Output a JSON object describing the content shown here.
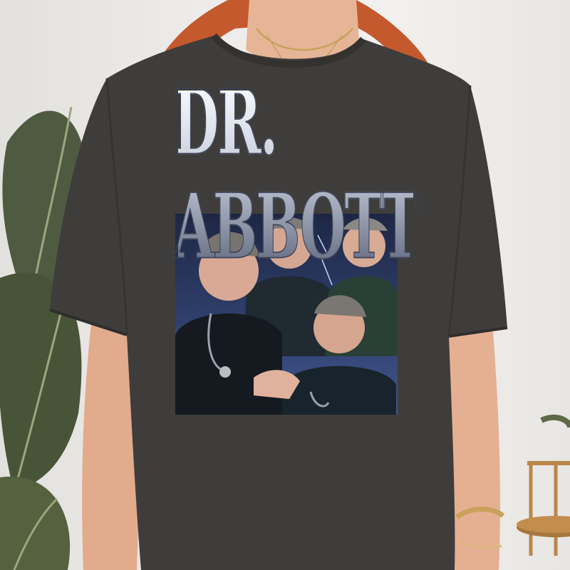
{
  "shirt": {
    "print_title": "DR. ABBOTT"
  },
  "colors": {
    "shirt": "#3e3d3b",
    "wall": "#eceae7",
    "hair": "#c4592e",
    "skin": "#e3ad8e",
    "print_bg": "#2c3a66",
    "scrubs": "#1d2b33",
    "plant": "#4d5a3f",
    "gold": "#c9a15b"
  },
  "icons": {
    "plant": "plant-leaves-icon",
    "stand": "brass-side-table-icon"
  }
}
